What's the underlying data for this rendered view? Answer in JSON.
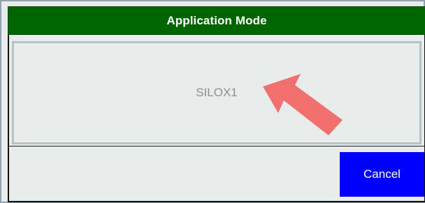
{
  "dialog": {
    "title": "Application Mode",
    "options": [
      {
        "label": "SILOX1"
      }
    ],
    "cancel_label": "Cancel"
  },
  "colors": {
    "title_bar": "#006400",
    "cancel_button": "#0000ff",
    "arrow": "#f07070",
    "background": "#e9eceb"
  },
  "icons": {
    "pointer": "arrow-pointer-icon"
  }
}
